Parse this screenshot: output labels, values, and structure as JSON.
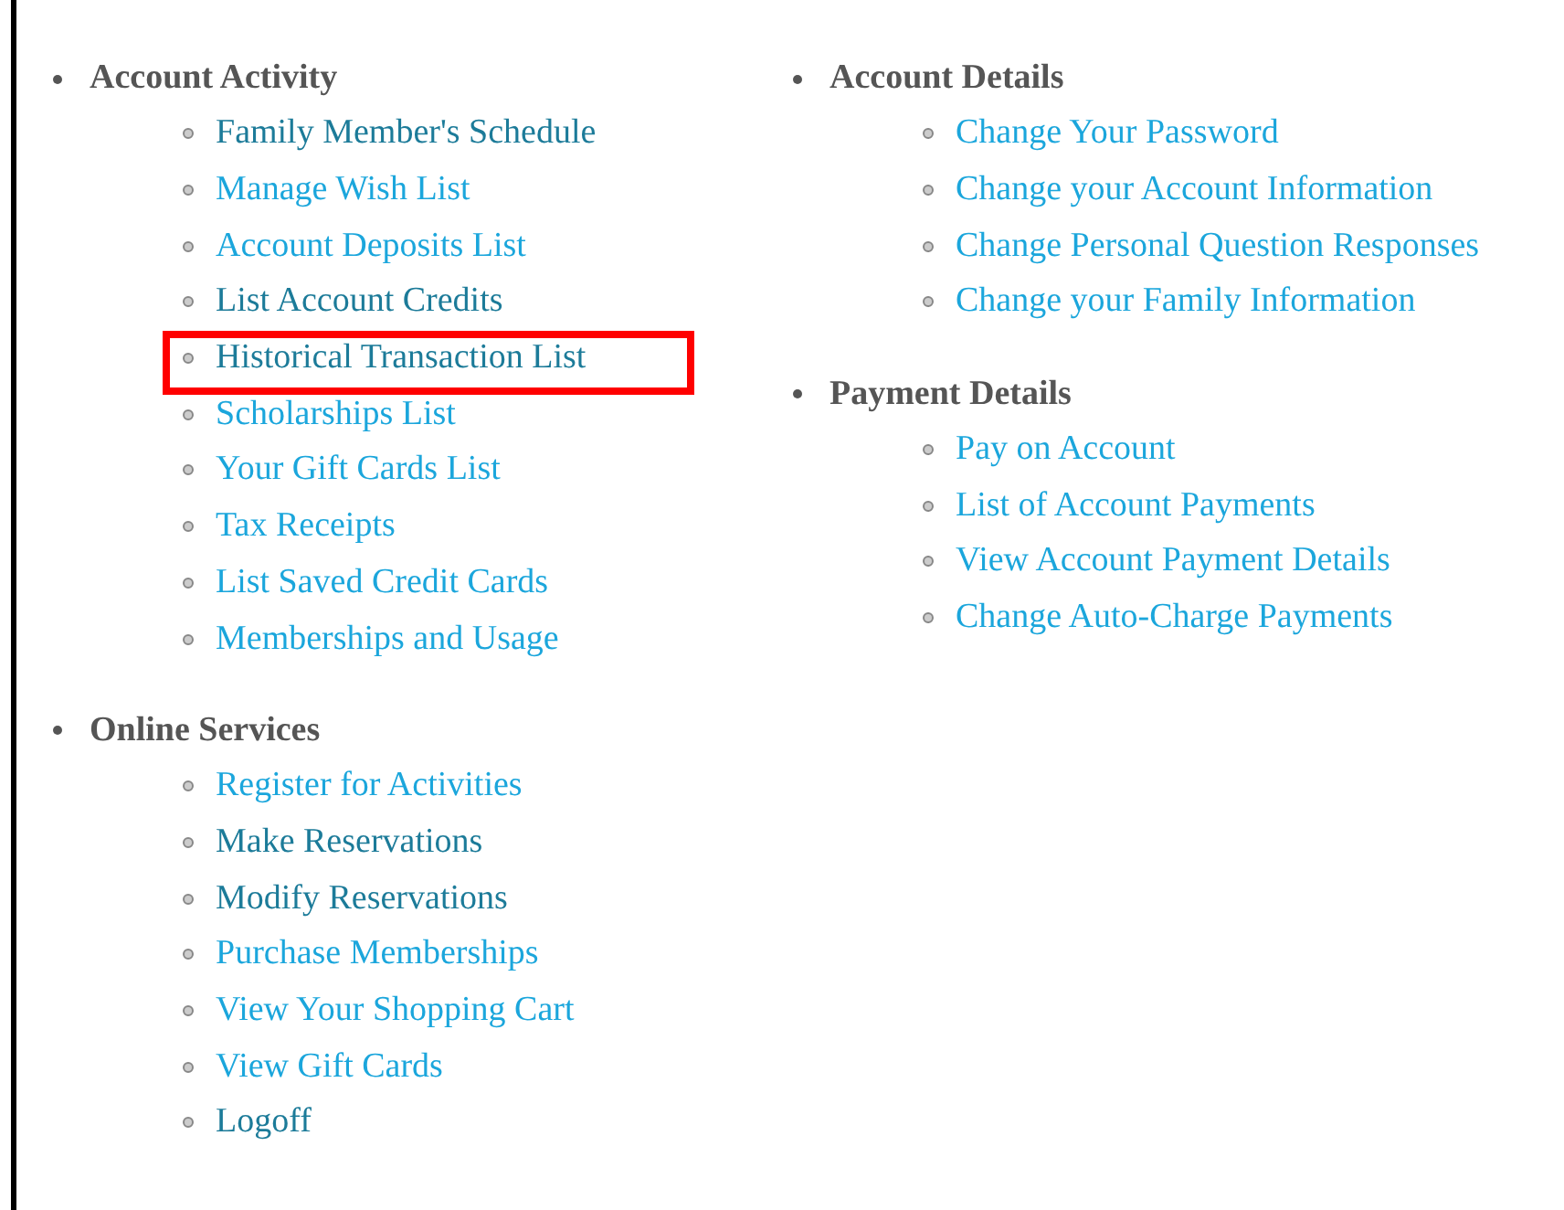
{
  "columns": [
    {
      "sections": [
        {
          "heading": "Account Activity",
          "links": [
            {
              "label": "Family Member's Schedule",
              "visited": true,
              "highlighted": false
            },
            {
              "label": "Manage Wish List",
              "visited": false,
              "highlighted": false
            },
            {
              "label": "Account Deposits List",
              "visited": false,
              "highlighted": false
            },
            {
              "label": "List Account Credits",
              "visited": true,
              "highlighted": false
            },
            {
              "label": "Historical Transaction List",
              "visited": true,
              "highlighted": true
            },
            {
              "label": "Scholarships List",
              "visited": false,
              "highlighted": false
            },
            {
              "label": "Your Gift Cards List",
              "visited": false,
              "highlighted": false
            },
            {
              "label": "Tax Receipts",
              "visited": false,
              "highlighted": false
            },
            {
              "label": "List Saved Credit Cards",
              "visited": false,
              "highlighted": false
            },
            {
              "label": "Memberships and Usage",
              "visited": false,
              "highlighted": false
            }
          ]
        },
        {
          "heading": "Online Services",
          "links": [
            {
              "label": "Register for Activities",
              "visited": false,
              "highlighted": false
            },
            {
              "label": "Make Reservations",
              "visited": true,
              "highlighted": false
            },
            {
              "label": "Modify Reservations",
              "visited": true,
              "highlighted": false
            },
            {
              "label": "Purchase Memberships",
              "visited": false,
              "highlighted": false
            },
            {
              "label": "View Your Shopping Cart",
              "visited": false,
              "highlighted": false
            },
            {
              "label": "View Gift Cards",
              "visited": false,
              "highlighted": false
            },
            {
              "label": "Logoff",
              "visited": true,
              "highlighted": false
            }
          ]
        }
      ]
    },
    {
      "sections": [
        {
          "heading": "Account Details",
          "links": [
            {
              "label": "Change Your Password",
              "visited": false,
              "highlighted": false
            },
            {
              "label": "Change your Account Information",
              "visited": false,
              "highlighted": false
            },
            {
              "label": "Change Personal Question Responses",
              "visited": false,
              "highlighted": false
            },
            {
              "label": "Change your Family Information",
              "visited": false,
              "highlighted": false
            }
          ]
        },
        {
          "heading": "Payment Details",
          "links": [
            {
              "label": "Pay on Account",
              "visited": false,
              "highlighted": false
            },
            {
              "label": "List of Account Payments",
              "visited": false,
              "highlighted": false
            },
            {
              "label": "View Account Payment Details",
              "visited": false,
              "highlighted": false
            },
            {
              "label": "Change Auto-Charge Payments",
              "visited": false,
              "highlighted": false
            }
          ]
        }
      ]
    }
  ]
}
